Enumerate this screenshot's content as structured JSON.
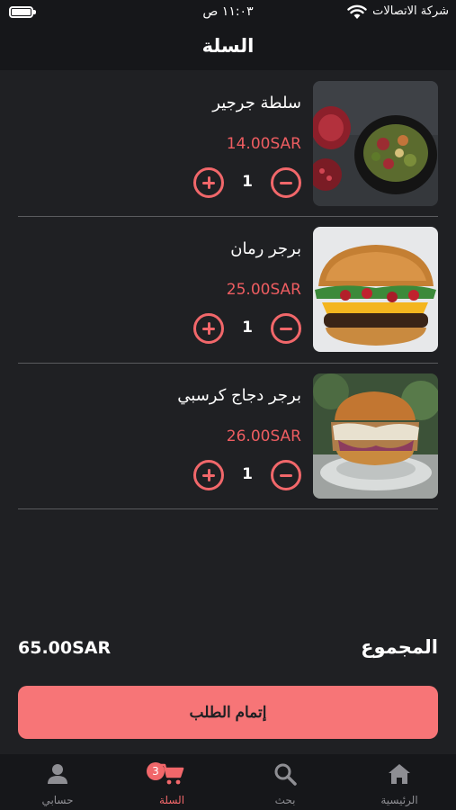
{
  "status_bar": {
    "carrier": "شركة الاتصالات",
    "time": "١١:٠٣ ص",
    "icons": [
      "wifi-icon",
      "battery-icon"
    ]
  },
  "header": {
    "title": "السلة"
  },
  "cart": {
    "items": [
      {
        "name": "سلطة جرجير",
        "price": "14.00SAR",
        "quantity": "1",
        "image": "salad-image"
      },
      {
        "name": "برجر رمان",
        "price": "25.00SAR",
        "quantity": "1",
        "image": "burger-image"
      },
      {
        "name": "برجر دجاج كرسبي",
        "price": "26.00SAR",
        "quantity": "1",
        "image": "chicken-burger-image"
      }
    ]
  },
  "summary": {
    "total_label": "المجموع",
    "total_value": "65.00SAR",
    "checkout_label": "إتمام الطلب"
  },
  "tab_bar": {
    "cart_badge": "3",
    "tabs": [
      {
        "label": "الرئيسية",
        "icon": "home-icon"
      },
      {
        "label": "بحث",
        "icon": "search-icon"
      },
      {
        "label": "السلة",
        "icon": "cart-icon",
        "active": true
      },
      {
        "label": "حسابي",
        "icon": "user-icon"
      }
    ]
  },
  "colors": {
    "background": "#1f2023",
    "accent": "#f1676a",
    "price": "#ee5d61",
    "checkout_button": "#f77577",
    "bars": "#16171a"
  }
}
